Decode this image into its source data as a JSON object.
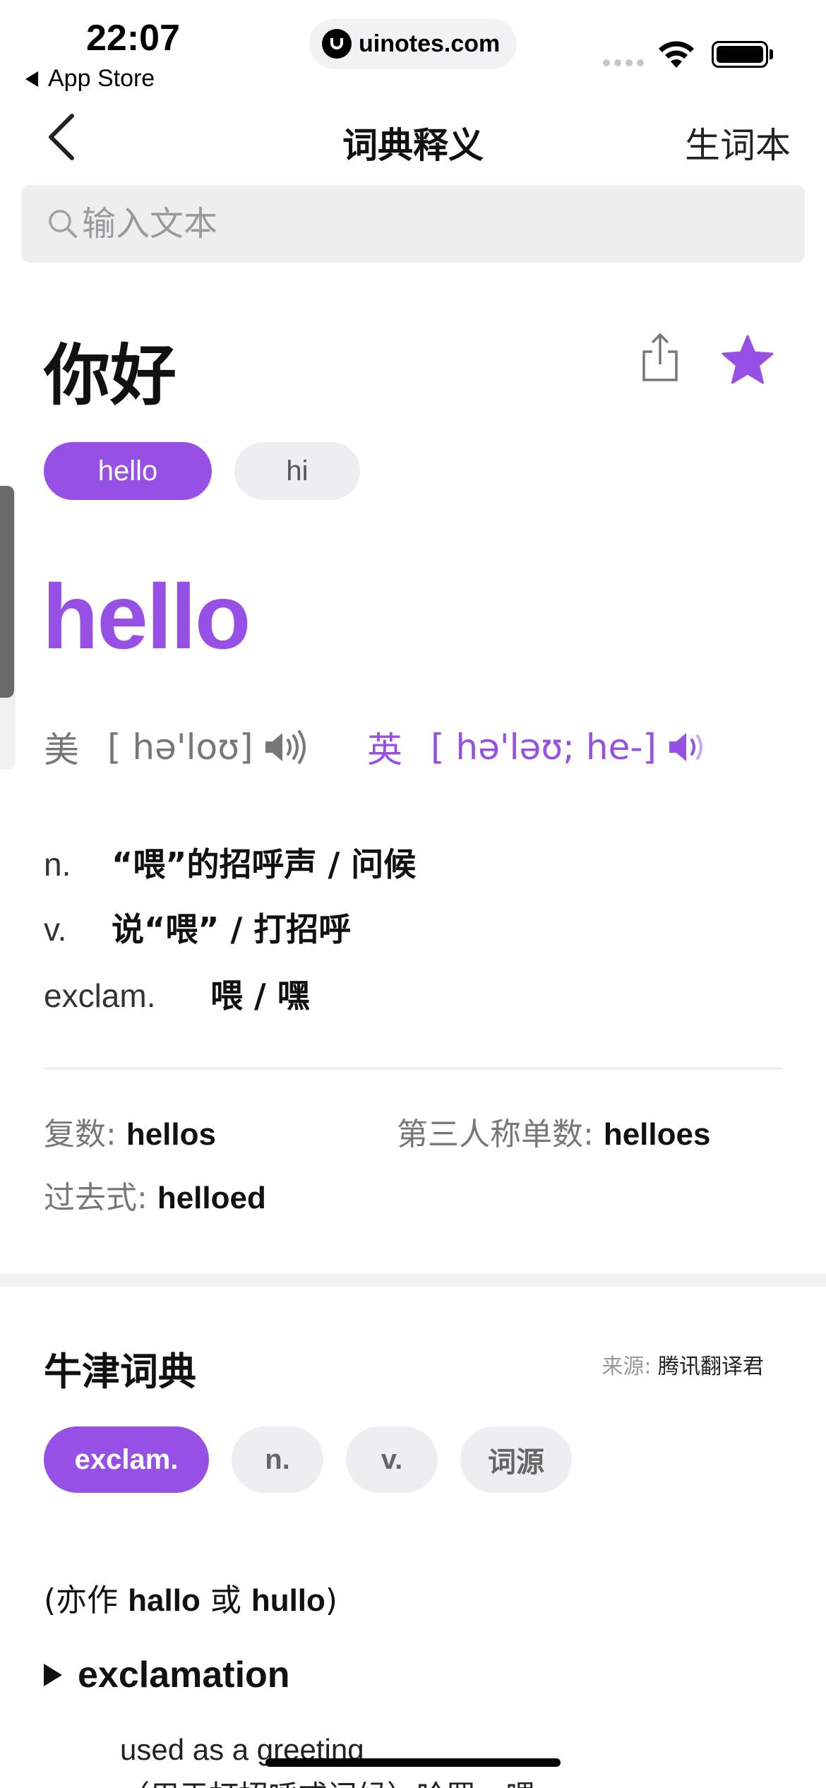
{
  "status_bar": {
    "time": "22:07",
    "back_app": "App Store",
    "url": "uinotes.com"
  },
  "nav": {
    "title": "词典释义",
    "right_label": "生词本"
  },
  "search": {
    "placeholder": "输入文本"
  },
  "entry": {
    "headword": "你好",
    "translations": [
      {
        "label": "hello",
        "selected": true
      },
      {
        "label": "hi",
        "selected": false
      }
    ],
    "selected_word": "hello",
    "pronunciations": [
      {
        "label": "美",
        "ipa": "[ hə'loʊ]"
      },
      {
        "label": "英",
        "ipa": "[ hə'ləʊ; he-]"
      }
    ],
    "definitions": [
      {
        "pos": "n.",
        "text": "“喂”的招呼声 / 问候"
      },
      {
        "pos": "v.",
        "text": "说“喂” / 打招呼"
      },
      {
        "pos": "exclam.",
        "text": "喂 / 嘿"
      }
    ],
    "inflections": [
      {
        "label": "复数:",
        "value": "hellos"
      },
      {
        "label": "第三人称单数:",
        "value": "helloes"
      },
      {
        "label": "过去式:",
        "value": "helloed"
      }
    ]
  },
  "oxford": {
    "title": "牛津词典",
    "source_label": "来源:",
    "source_value": "腾讯翻译君",
    "tabs": [
      {
        "label": "exclam.",
        "selected": true
      },
      {
        "label": "n.",
        "selected": false
      },
      {
        "label": "v.",
        "selected": false
      },
      {
        "label": "词源",
        "selected": false
      }
    ],
    "also_prefix": "(亦作 ",
    "also_word1": "hallo",
    "also_mid": " 或 ",
    "also_word2": "hullo",
    "also_suffix": ")",
    "pos_heading": "exclamation",
    "sense_en": "used as a greeting",
    "sense_cn": "（用于打招呼或问候）哈罗，喂"
  },
  "colors": {
    "accent": "#9650e6",
    "chip_inactive": "#eeeef2",
    "text_primary": "#111111",
    "text_secondary": "#777777"
  },
  "icons": [
    "chevron-left-icon",
    "search-icon",
    "share-icon",
    "star-icon",
    "speaker-icon",
    "wifi-icon",
    "battery-icon"
  ]
}
